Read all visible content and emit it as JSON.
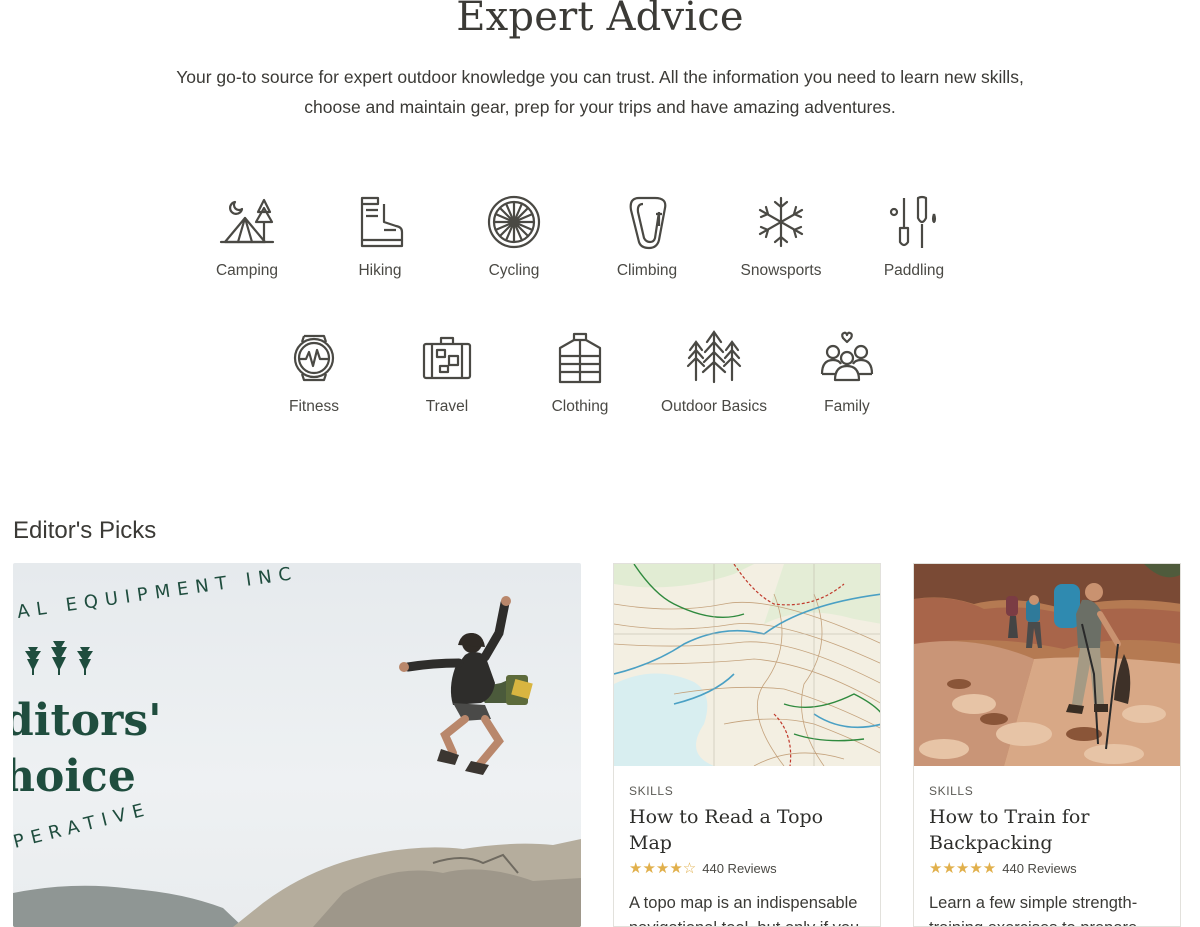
{
  "header": {
    "title": "Expert Advice",
    "description": "Your go-to source for expert outdoor knowledge you can trust. All the information you need to learn new skills, choose and maintain gear, prep for your trips and have amazing adventures."
  },
  "categories": [
    {
      "label": "Camping",
      "icon": "tent-icon"
    },
    {
      "label": "Hiking",
      "icon": "hiking-boot-icon"
    },
    {
      "label": "Cycling",
      "icon": "bike-wheel-icon"
    },
    {
      "label": "Climbing",
      "icon": "carabiner-icon"
    },
    {
      "label": "Snowsports",
      "icon": "snowflake-icon"
    },
    {
      "label": "Paddling",
      "icon": "paddles-icon"
    },
    {
      "label": "Fitness",
      "icon": "fitness-watch-icon"
    },
    {
      "label": "Travel",
      "icon": "suitcase-icon"
    },
    {
      "label": "Clothing",
      "icon": "vest-icon"
    },
    {
      "label": "Outdoor Basics",
      "icon": "trees-icon"
    },
    {
      "label": "Family",
      "icon": "family-icon"
    }
  ],
  "editors_picks": {
    "heading": "Editor's Picks",
    "feature": {
      "badge_lines": [
        "ditors'",
        "hoice"
      ],
      "ring_text": "AL EQUIPMENT INC",
      "ring_text_bottom": "PERATIVE"
    },
    "cards": [
      {
        "kicker": "SKILLS",
        "title": "How to Read a Topo Map",
        "stars": "★★★★☆",
        "rating": 4,
        "reviews": "440 Reviews",
        "excerpt": "A topo map is an indispensable navigational tool, but only if you know how"
      },
      {
        "kicker": "SKILLS",
        "title": "How to Train for Backpacking",
        "stars": "★★★★★",
        "rating": 4.5,
        "reviews": "440 Reviews",
        "excerpt": "Learn a few simple strength-training exercises to prepare"
      }
    ]
  },
  "colors": {
    "text": "#3b3a36",
    "icon": "#4a4944",
    "star": "#e1b04c",
    "badge_green": "#1f4d3e"
  }
}
